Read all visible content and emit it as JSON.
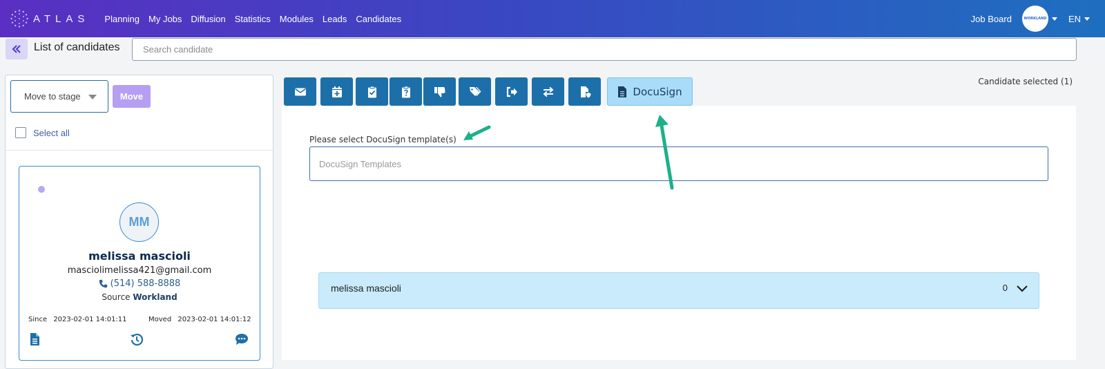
{
  "header": {
    "logo_text": "ATLAS",
    "nav": [
      "Planning",
      "My Jobs",
      "Diffusion",
      "Statistics",
      "Modules",
      "Leads",
      "Candidates"
    ],
    "job_board": "Job Board",
    "avatar_text": "WORKLAND",
    "language": "EN"
  },
  "subheader": {
    "collapse_icon": "double-chevron-left-icon",
    "title": "List of candidates",
    "search_placeholder": "Search candidate"
  },
  "left": {
    "stage_select": "Move to stage",
    "move_button": "Move",
    "select_all": "Select all",
    "candidate": {
      "initials": "MM",
      "name": "melissa mascioli",
      "email": "masciolimelissa421@gmail.com",
      "phone": "(514) 588-8888",
      "source_label": "Source",
      "source_value": "Workland",
      "since_label": "Since",
      "since_value": "2023-02-01 14:01:11",
      "moved_label": "Moved",
      "moved_value": "2023-02-01 14:01:12"
    }
  },
  "toolbar": {
    "icons": [
      "email-icon",
      "calendar-add-icon",
      "clipboard-check-icon",
      "clipboard-question-icon",
      "thumbs-down-icon",
      "tags-icon",
      "sign-out-icon",
      "exchange-icon",
      "file-shield-icon"
    ],
    "docusign_label": "DocuSign"
  },
  "candidate_selected": "Candidate selected",
  "candidate_selected_count": "(1)",
  "docusign": {
    "label": "Please select DocuSign template(s)",
    "placeholder": "DocuSign Templates"
  },
  "accordion": {
    "name": "melissa mascioli",
    "count": "0"
  },
  "colors": {
    "primary": "#1d6fa9",
    "docusign_bg": "#a9dcf8",
    "accordion_bg": "#c9ebfb",
    "annotation_arrow": "#1db08a"
  }
}
